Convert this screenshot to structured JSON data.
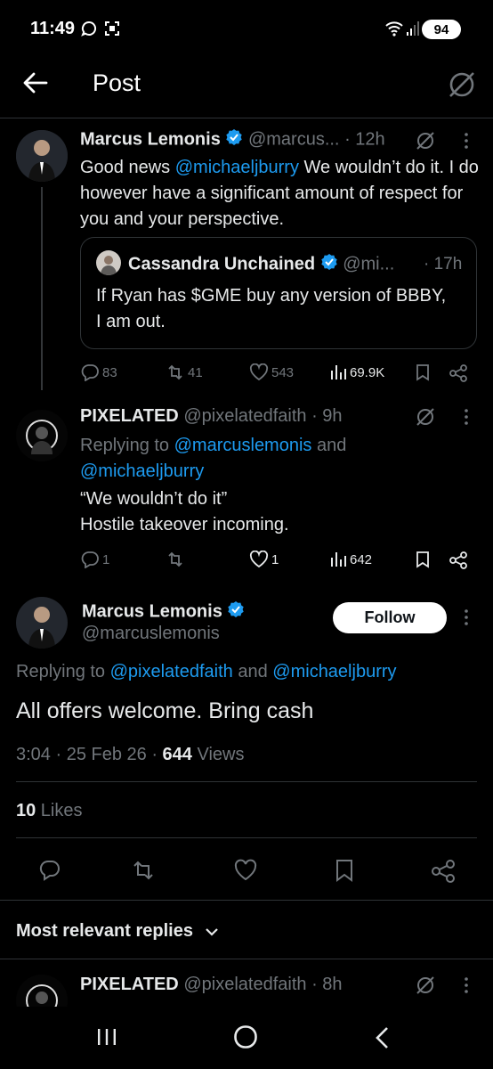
{
  "status": {
    "time": "11:49",
    "battery": "94"
  },
  "header": {
    "title": "Post"
  },
  "tweet1": {
    "name": "Marcus Lemonis",
    "handle": "@marcus...",
    "time": "· 12h",
    "text_a": "Good news ",
    "mention": "@michaeljburry",
    "text_b": " We wouldn’t do it. I do however  have a significant amount of respect for you and your perspective.",
    "quote": {
      "name": "Cassandra Unchained",
      "handle": "@mi...",
      "time": "· 17h",
      "text": "If Ryan has $GME buy any version of BBBY, I am out."
    },
    "stats": {
      "replies": "83",
      "reposts": "41",
      "likes": "543",
      "views": "69.9K"
    }
  },
  "tweet2": {
    "name": "PIXELATED",
    "handle": "@pixelatedfaith",
    "time": "· 9h",
    "replying_label": "Replying to ",
    "replying_a": "@marcuslemonis",
    "replying_and": " and",
    "replying_b": "@michaeljburry",
    "text_line1": "“We wouldn’t do it”",
    "text_line2": "Hostile takeover incoming.",
    "stats": {
      "replies": "1",
      "reposts": "",
      "likes": "1",
      "views": "642"
    }
  },
  "main": {
    "name": "Marcus Lemonis",
    "handle": "@marcuslemonis",
    "follow_label": "Follow",
    "replying_label": "Replying to ",
    "replying_a": "@pixelatedfaith",
    "replying_and": " and ",
    "replying_b": "@michaeljburry",
    "text": "All offers welcome. Bring cash",
    "timestamp": "3:04 · 25 Feb 26 · ",
    "views_count": "644",
    "views_label": " Views",
    "likes_count": "10",
    "likes_label": " Likes"
  },
  "replies": {
    "section_label": "Most relevant replies",
    "first": {
      "name": "PIXELATED",
      "handle": "@pixelatedfaith",
      "time": "· 8h"
    }
  },
  "colors": {
    "accent": "#1d9bf0",
    "muted": "#71767b",
    "divider": "#2f3336",
    "verified": "#1d9bf0"
  }
}
